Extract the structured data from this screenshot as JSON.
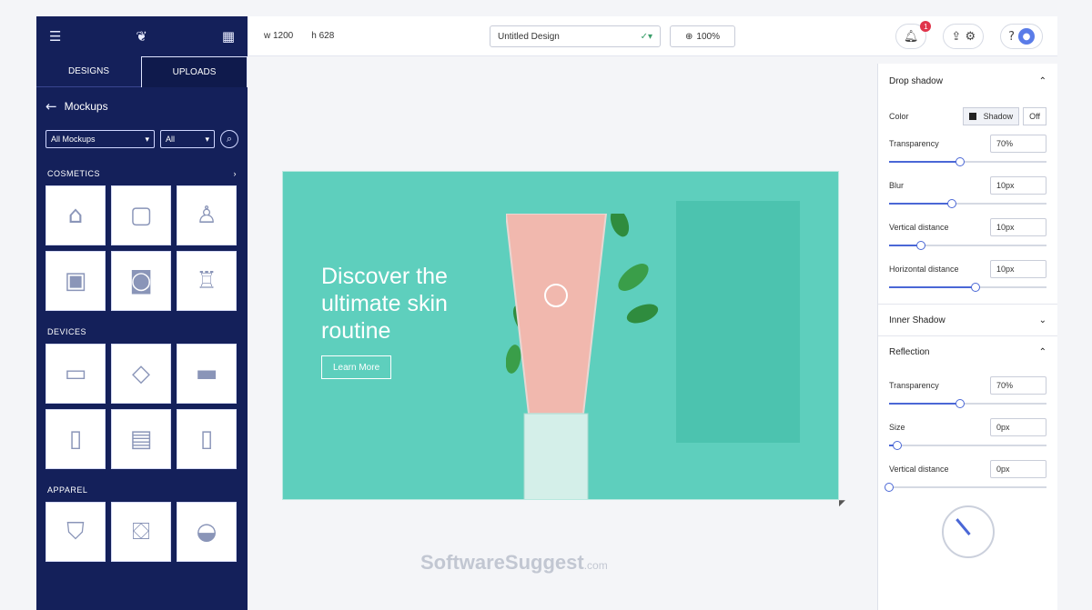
{
  "sidebar": {
    "tabs": [
      "DESIGNS",
      "UPLOADS"
    ],
    "title": "Mockups",
    "filter_1": "All Mockups",
    "filter_2": "All",
    "sections": [
      {
        "label": "COSMETICS",
        "items": [
          "tube",
          "jar",
          "bottle",
          "box",
          "pot",
          "pump"
        ]
      },
      {
        "label": "DEVICES",
        "items": [
          "laptop",
          "tablet",
          "monitor",
          "phone",
          "browser",
          "mobile"
        ]
      },
      {
        "label": "APPAREL",
        "items": [
          "tshirt",
          "tote",
          "cap"
        ]
      }
    ]
  },
  "topbar": {
    "width": "w 1200",
    "height": "h 628",
    "design_name": "Untitled Design",
    "zoom": "100%",
    "notification_count": "1"
  },
  "canvas": {
    "headline": "Discover the ultimate skin routine",
    "cta": "Learn More",
    "bg_color": "#5ecfbd"
  },
  "panel": {
    "title": "Drop shadow",
    "color_label": "Color",
    "toggle_on": "Shadow",
    "toggle_off": "Off",
    "fields": [
      {
        "label": "Transparency",
        "value": "70%",
        "level": 0.45
      },
      {
        "label": "Blur",
        "value": "10px",
        "level": 0.4
      },
      {
        "label": "Vertical distance",
        "value": "10px",
        "level": 0.2
      },
      {
        "label": "Horizontal distance",
        "value": "10px",
        "level": 0.55
      }
    ],
    "section_2": "Inner Shadow",
    "section_3": "Reflection",
    "fields_2": [
      {
        "label": "Transparency",
        "value": "70%",
        "level": 0.45
      },
      {
        "label": "Size",
        "value": "0px",
        "level": 0.05
      },
      {
        "label": "Vertical distance",
        "value": "0px",
        "level": 0.0
      }
    ]
  },
  "watermark": {
    "main": "SoftwareSuggest",
    "suffix": ".com"
  }
}
